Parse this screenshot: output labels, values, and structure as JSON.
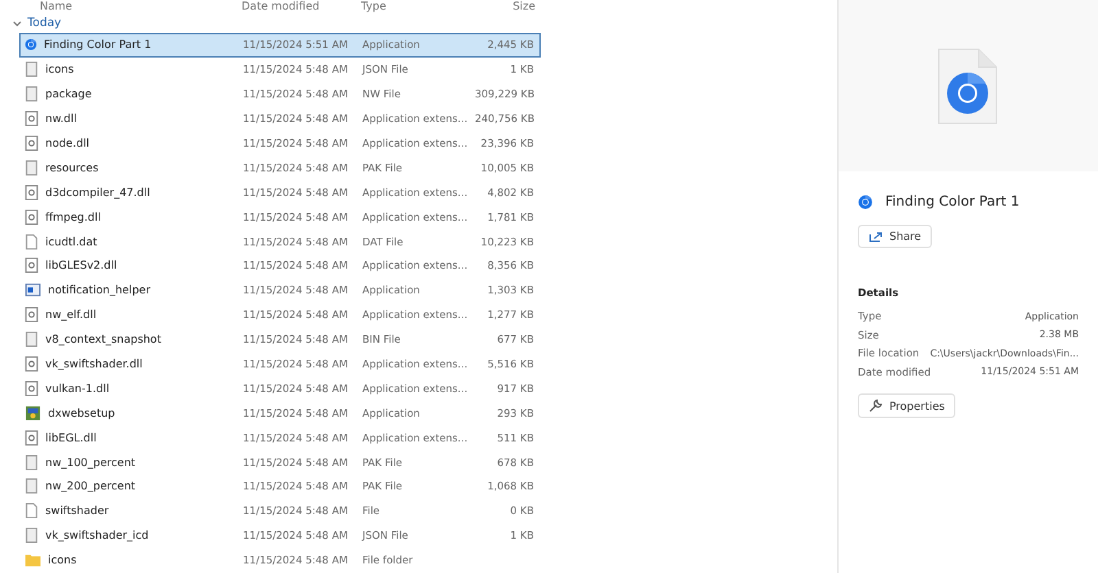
{
  "columns": [
    "Name",
    "Date modified",
    "Type",
    "Size"
  ],
  "group": {
    "label": "Today",
    "expanded": true
  },
  "rows": [
    {
      "name": "Finding Color Part 1",
      "date": "11/15/2024 5:51 AM",
      "type": "Application",
      "size": "2,445 KB",
      "kind": "chrome",
      "selected": true
    },
    {
      "name": "icons",
      "date": "11/15/2024 5:48 AM",
      "type": "JSON File",
      "size": "1 KB",
      "kind": "file",
      "selected": false
    },
    {
      "name": "package",
      "date": "11/15/2024 5:48 AM",
      "type": "NW File",
      "size": "309,229 KB",
      "kind": "file",
      "selected": false
    },
    {
      "name": "nw.dll",
      "date": "11/15/2024 5:48 AM",
      "type": "Application extens...",
      "size": "240,756 KB",
      "kind": "dll",
      "selected": false
    },
    {
      "name": "node.dll",
      "date": "11/15/2024 5:48 AM",
      "type": "Application extens...",
      "size": "23,396 KB",
      "kind": "dll",
      "selected": false
    },
    {
      "name": "resources",
      "date": "11/15/2024 5:48 AM",
      "type": "PAK File",
      "size": "10,005 KB",
      "kind": "file",
      "selected": false
    },
    {
      "name": "d3dcompiler_47.dll",
      "date": "11/15/2024 5:48 AM",
      "type": "Application extens...",
      "size": "4,802 KB",
      "kind": "dll",
      "selected": false
    },
    {
      "name": "ffmpeg.dll",
      "date": "11/15/2024 5:48 AM",
      "type": "Application extens...",
      "size": "1,781 KB",
      "kind": "dll",
      "selected": false
    },
    {
      "name": "icudtl.dat",
      "date": "11/15/2024 5:48 AM",
      "type": "DAT File",
      "size": "10,223 KB",
      "kind": "blank",
      "selected": false
    },
    {
      "name": "libGLESv2.dll",
      "date": "11/15/2024 5:48 AM",
      "type": "Application extens...",
      "size": "8,356 KB",
      "kind": "dll",
      "selected": false
    },
    {
      "name": "notification_helper",
      "date": "11/15/2024 5:48 AM",
      "type": "Application",
      "size": "1,303 KB",
      "kind": "window",
      "selected": false
    },
    {
      "name": "nw_elf.dll",
      "date": "11/15/2024 5:48 AM",
      "type": "Application extens...",
      "size": "1,277 KB",
      "kind": "dll",
      "selected": false
    },
    {
      "name": "v8_context_snapshot",
      "date": "11/15/2024 5:48 AM",
      "type": "BIN File",
      "size": "677 KB",
      "kind": "file",
      "selected": false
    },
    {
      "name": "vk_swiftshader.dll",
      "date": "11/15/2024 5:48 AM",
      "type": "Application extens...",
      "size": "5,516 KB",
      "kind": "dll",
      "selected": false
    },
    {
      "name": "vulkan-1.dll",
      "date": "11/15/2024 5:48 AM",
      "type": "Application extens...",
      "size": "917 KB",
      "kind": "dll",
      "selected": false
    },
    {
      "name": "dxwebsetup",
      "date": "11/15/2024 5:48 AM",
      "type": "Application",
      "size": "293 KB",
      "kind": "setup",
      "selected": false
    },
    {
      "name": "libEGL.dll",
      "date": "11/15/2024 5:48 AM",
      "type": "Application extens...",
      "size": "511 KB",
      "kind": "dll",
      "selected": false
    },
    {
      "name": "nw_100_percent",
      "date": "11/15/2024 5:48 AM",
      "type": "PAK File",
      "size": "678 KB",
      "kind": "file",
      "selected": false
    },
    {
      "name": "nw_200_percent",
      "date": "11/15/2024 5:48 AM",
      "type": "PAK File",
      "size": "1,068 KB",
      "kind": "file",
      "selected": false
    },
    {
      "name": "swiftshader",
      "date": "11/15/2024 5:48 AM",
      "type": "File",
      "size": "0 KB",
      "kind": "blank",
      "selected": false
    },
    {
      "name": "vk_swiftshader_icd",
      "date": "11/15/2024 5:48 AM",
      "type": "JSON File",
      "size": "1 KB",
      "kind": "file",
      "selected": false
    },
    {
      "name": "icons",
      "date": "11/15/2024 5:48 AM",
      "type": "File folder",
      "kind": "folder",
      "selected": false
    }
  ],
  "details_pane": {
    "title": "Finding Color Part 1",
    "share": "Share",
    "heading": "Details",
    "fields": [
      {
        "label": "Type",
        "value": "Application"
      },
      {
        "label": "Size",
        "value": "2.38 MB"
      },
      {
        "label": "File location",
        "value": "C:\\Users\\jackr\\Downloads\\Fin..."
      },
      {
        "label": "Date modified",
        "value": "11/15/2024 5:51 AM"
      }
    ],
    "properties": "Properties"
  }
}
